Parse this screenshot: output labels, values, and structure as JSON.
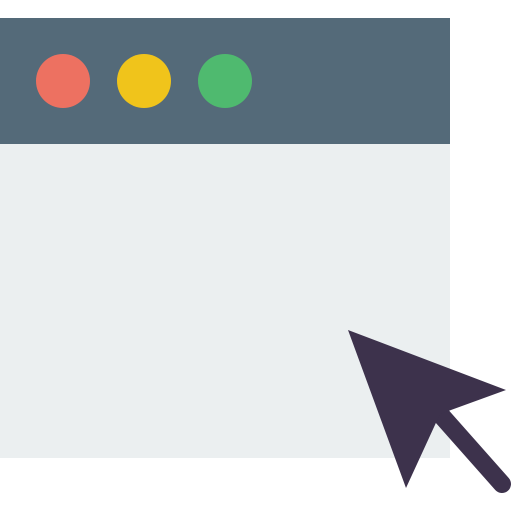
{
  "colors": {
    "titlebar": "#546a79",
    "content": "#ebeff0",
    "close": "#ed7161",
    "minimize": "#f0c41b",
    "maximize": "#4fba6f",
    "cursor": "#3d324c"
  },
  "window": {
    "titlebar": {
      "buttons": [
        {
          "name": "close",
          "icon": "close-dot-icon"
        },
        {
          "name": "minimize",
          "icon": "minimize-dot-icon"
        },
        {
          "name": "maximize",
          "icon": "maximize-dot-icon"
        }
      ]
    }
  },
  "cursor": {
    "icon": "mouse-pointer-icon"
  }
}
